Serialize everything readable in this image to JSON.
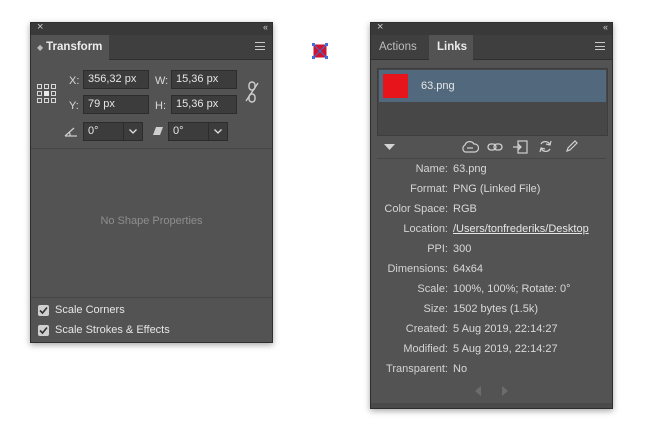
{
  "transform_panel": {
    "close_glyph": "×",
    "collapse_glyph": "‹‹",
    "tab_title": "Transform",
    "x_label": "X:",
    "x_value": "356,32 px",
    "y_label": "Y:",
    "y_value": "79 px",
    "w_label": "W:",
    "w_value": "15,36 px",
    "h_label": "H:",
    "h_value": "15,36 px",
    "rotate_value": "0°",
    "shear_value": "0°",
    "no_shape_text": "No Shape Properties",
    "scale_corners_label": "Scale Corners",
    "scale_corners_checked": true,
    "scale_strokes_label": "Scale Strokes & Effects",
    "scale_strokes_checked": true
  },
  "links_panel": {
    "close_glyph": "×",
    "collapse_glyph": "‹‹",
    "tab_actions": "Actions",
    "tab_links": "Links",
    "active_tab": "Links",
    "list_item": {
      "name": "63.png",
      "thumb_color": "#e8141b"
    },
    "info": [
      {
        "label": "Name:",
        "value": "63.png"
      },
      {
        "label": "Format:",
        "value": "PNG (Linked File)"
      },
      {
        "label": "Color Space:",
        "value": "RGB"
      },
      {
        "label": "Location:",
        "value": "/Users/tonfrederiks/Desktop"
      },
      {
        "label": "PPI:",
        "value": "300"
      },
      {
        "label": "Dimensions:",
        "value": "64x64"
      },
      {
        "label": "Scale:",
        "value": "100%, 100%; Rotate: 0°"
      },
      {
        "label": "Size:",
        "value": "1502 bytes (1.5k)"
      },
      {
        "label": "Created:",
        "value": "5 Aug 2019, 22:14:27"
      },
      {
        "label": "Modified:",
        "value": "5 Aug 2019, 22:14:27"
      },
      {
        "label": "Transparent:",
        "value": "No"
      }
    ]
  },
  "colors": {
    "panel_bg": "#535353",
    "selection_bg": "#51687d",
    "selection_outline": "#3b6fe0",
    "shape_fill": "#d0142c"
  }
}
